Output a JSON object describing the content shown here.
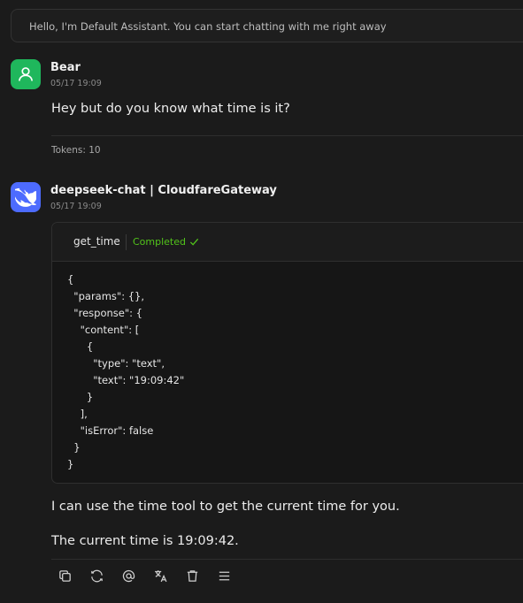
{
  "welcome": {
    "text": "Hello, I'm Default Assistant. You can start chatting with me right away"
  },
  "user_message": {
    "name": "Bear",
    "time": "05/17 19:09",
    "text": "Hey but do you know what time is it?",
    "tokens": "Tokens: 10",
    "avatar_color": "#1fb75c"
  },
  "assistant_message": {
    "name": "deepseek-chat | CloudfareGateway",
    "time": "05/17 19:09",
    "avatar_color": "#4d6bfe",
    "tool": {
      "name": "get_time",
      "status": "Completed",
      "status_icon": "check-icon",
      "body": "{\n  \"params\": {},\n  \"response\": {\n    \"content\": [\n      {\n        \"type\": \"text\",\n        \"text\": \"19:09:42\"\n      }\n    ],\n    \"isError\": false\n  }\n}"
    },
    "text1": "I can use the time tool to get the current time for you.",
    "text2": "The current time is 19:09:42.",
    "actions": [
      "copy-icon",
      "regenerate-icon",
      "mention-icon",
      "translate-icon",
      "delete-icon",
      "menu-icon"
    ]
  }
}
